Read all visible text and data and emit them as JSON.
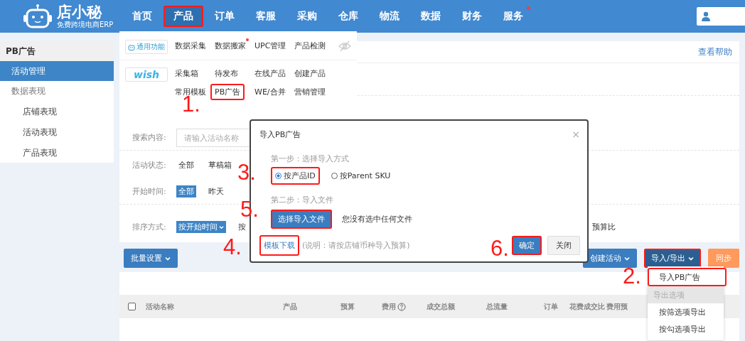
{
  "logo": {
    "name": "店小秘",
    "tagline": "免费跨境电商ERP"
  },
  "nav": [
    {
      "label": "首页",
      "selected": false,
      "highlighted": false,
      "dot": false
    },
    {
      "label": "产品",
      "selected": true,
      "highlighted": true,
      "dot": false
    },
    {
      "label": "订单",
      "selected": false,
      "highlighted": false,
      "dot": false
    },
    {
      "label": "客服",
      "selected": false,
      "highlighted": false,
      "dot": false
    },
    {
      "label": "采购",
      "selected": false,
      "highlighted": false,
      "dot": false
    },
    {
      "label": "仓库",
      "selected": false,
      "highlighted": false,
      "dot": false
    },
    {
      "label": "物流",
      "selected": false,
      "highlighted": false,
      "dot": false
    },
    {
      "label": "数据",
      "selected": false,
      "highlighted": false,
      "dot": false
    },
    {
      "label": "财务",
      "selected": false,
      "highlighted": false,
      "dot": false
    },
    {
      "label": "服务",
      "selected": false,
      "highlighted": false,
      "dot": true
    }
  ],
  "sidebar": {
    "title": "PB广告",
    "items": [
      {
        "label": "活动管理",
        "selected": true
      },
      {
        "label": "数据表现",
        "selected": false,
        "children": [
          {
            "label": "店铺表现",
            "selected": false
          },
          {
            "label": "活动表现",
            "selected": false
          },
          {
            "label": "产品表现",
            "selected": false
          }
        ]
      }
    ]
  },
  "help_link": "查看帮助",
  "filters": {
    "search": {
      "label": "搜索内容:",
      "placeholder": "请输入活动名称"
    },
    "rows": [
      {
        "label": "活动状态:",
        "options": [
          {
            "label": "全部",
            "selected": false
          },
          {
            "label": "草稿箱",
            "selected": false
          }
        ]
      },
      {
        "label": "开始时间:",
        "options": [
          {
            "label": "全部",
            "selected": true
          },
          {
            "label": "昨天",
            "selected": false
          }
        ]
      },
      {
        "label": "排序方式:",
        "options": [
          {
            "label": "按开始时间",
            "selected": true
          },
          {
            "label": "按",
            "selected": false
          }
        ],
        "trailing": "预算比"
      }
    ]
  },
  "toolbar": {
    "batch": "批量设置",
    "create": "创建活动",
    "import_export": {
      "label": "导入/导出",
      "highlighted": true
    },
    "sync": "同步"
  },
  "table": {
    "select_all": {
      "checked": false
    },
    "columns": [
      "活动名称",
      "产品",
      "预算",
      "费用",
      "成交总额",
      "总流量",
      "订单",
      "花费成交比",
      "费用预"
    ]
  },
  "product_menu": {
    "groups": [
      {
        "badge": "通用功能",
        "kind": "general",
        "items": [
          {
            "label": "数据采集",
            "dot": false,
            "highlighted": false
          },
          {
            "label": "数据搬家",
            "dot": true,
            "highlighted": false
          },
          {
            "label": "UPC管理",
            "dot": false,
            "highlighted": false
          },
          {
            "label": "产品检测",
            "dot": false,
            "highlighted": false
          }
        ]
      },
      {
        "badge": "wish",
        "kind": "wish",
        "items": [
          {
            "label": "采集箱",
            "dot": false,
            "highlighted": false
          },
          {
            "label": "待发布",
            "dot": false,
            "highlighted": false
          },
          {
            "label": "在线产品",
            "dot": false,
            "highlighted": false
          },
          {
            "label": "创建产品",
            "dot": false,
            "highlighted": false
          },
          {
            "label": "常用模板",
            "dot": false,
            "highlighted": false
          },
          {
            "label": "PB广告",
            "dot": false,
            "highlighted": true
          },
          {
            "label": "WE/合并",
            "dot": false,
            "highlighted": false
          },
          {
            "label": "营销管理",
            "dot": false,
            "highlighted": false
          }
        ]
      }
    ]
  },
  "modal": {
    "title": "导入PB广告",
    "close": "×",
    "step1": "第一步：选择导入方式",
    "options": [
      {
        "label": "按产品ID",
        "selected": true,
        "highlighted": true
      },
      {
        "label": "按Parent SKU",
        "selected": false,
        "highlighted": false
      }
    ],
    "step2": "第二步：导入文件",
    "choose_button": {
      "label": "选择导入文件",
      "highlighted": true
    },
    "file_status": "您没有选中任何文件",
    "template_link": {
      "label": "模板下载",
      "highlighted": true
    },
    "note": "(说明：请按店铺币种导入预算)",
    "confirm": {
      "label": "确定",
      "highlighted": true
    },
    "cancel": "关闭"
  },
  "export_menu": [
    {
      "label": "导入PB广告",
      "kind": "item",
      "highlighted": true
    },
    {
      "label": "导出选项",
      "kind": "header",
      "highlighted": false
    },
    {
      "label": "按筛选项导出",
      "kind": "item",
      "highlighted": false
    },
    {
      "label": "按勾选项导出",
      "kind": "item",
      "highlighted": false
    }
  ],
  "annotations": [
    "1.",
    "2.",
    "3.",
    "4.",
    "5.",
    "6."
  ]
}
